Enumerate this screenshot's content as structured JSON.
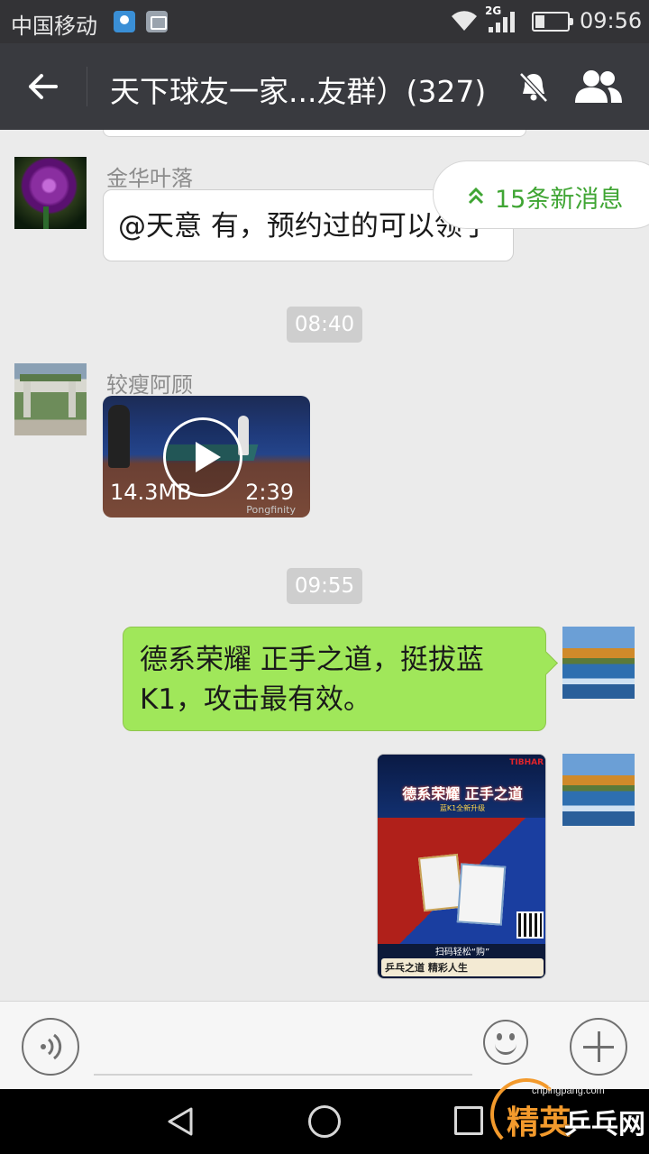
{
  "status_bar": {
    "carrier": "中国移动",
    "network": "2G",
    "time": "09:56",
    "icons": [
      "location-icon",
      "image-notification-icon",
      "wifi-icon",
      "signal-icon",
      "battery-icon"
    ]
  },
  "header": {
    "title": "天下球友一家...友群）(327)",
    "icons": [
      "back-arrow-icon",
      "mute-bell-icon",
      "group-members-icon"
    ]
  },
  "new_messages_badge": "15条新消息",
  "messages": [
    {
      "sender": "金华叶落",
      "text": "@天意 有，预约过的可以领了"
    },
    {
      "time": "08:40"
    },
    {
      "sender": "较瘦阿顾",
      "type": "video",
      "size": "14.3MB",
      "duration": "2:39",
      "watermark": "Pongfinity"
    },
    {
      "time": "09:55"
    },
    {
      "sender": "self",
      "text": "德系荣耀 正手之道，挺拔蓝K1，攻击最有效。"
    },
    {
      "sender": "self",
      "type": "image",
      "poster": {
        "brand": "TIBHAR",
        "title": "德系荣耀 正手之道",
        "subtitle": "蓝K1全新升级",
        "scan_text": "扫码轻松“购”",
        "footer": "乒乓之道 精彩人生"
      }
    }
  ],
  "input_bar": {
    "placeholder": "",
    "icons": [
      "voice-icon",
      "emoji-icon",
      "plus-icon"
    ]
  },
  "watermark": {
    "url": "cnpingpang.com",
    "text_a": "精英",
    "text_b": "乒乓网"
  },
  "colors": {
    "header_bg": "#393a3f",
    "chat_bg": "#ebebeb",
    "sent_bubble": "#a0e75a",
    "new_msg_text": "#3fa533"
  }
}
